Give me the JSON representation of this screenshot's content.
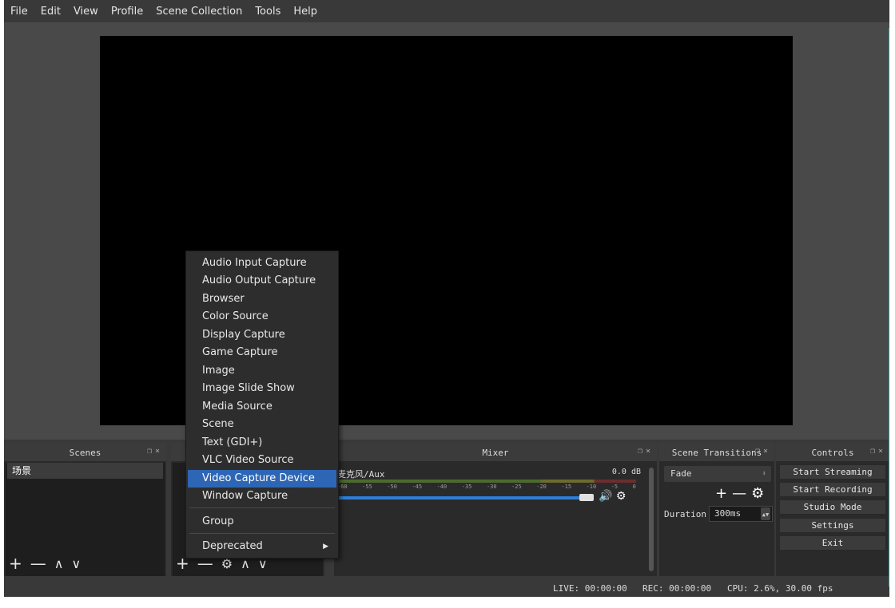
{
  "menubar": [
    "File",
    "Edit",
    "View",
    "Profile",
    "Scene Collection",
    "Tools",
    "Help"
  ],
  "docks": {
    "scenes": {
      "title": "Scenes",
      "items": [
        "场景"
      ]
    },
    "mixer": {
      "title": "Mixer",
      "track_name": "麦克风/Aux",
      "db": "0.0 dB",
      "ticks": [
        "-60",
        "-55",
        "-50",
        "-45",
        "-40",
        "-35",
        "-30",
        "-25",
        "-20",
        "-15",
        "-10",
        "-5",
        "0"
      ],
      "volume_level": 0.82
    },
    "transitions": {
      "title": "Scene Transitions",
      "selected": "Fade",
      "duration_label": "Duration",
      "duration_value": "300ms"
    },
    "controls": {
      "title": "Controls",
      "buttons": [
        "Start Streaming",
        "Start Recording",
        "Studio Mode",
        "Settings",
        "Exit"
      ]
    }
  },
  "context_menu": {
    "items": [
      "Audio Input Capture",
      "Audio Output Capture",
      "Browser",
      "Color Source",
      "Display Capture",
      "Game Capture",
      "Image",
      "Image Slide Show",
      "Media Source",
      "Scene",
      "Text (GDI+)",
      "VLC Video Source",
      "Video Capture Device",
      "Window Capture"
    ],
    "selected": "Video Capture Device",
    "group": "Group",
    "deprecated": "Deprecated"
  },
  "status": {
    "live": "LIVE: 00:00:00",
    "rec": "REC: 00:00:00",
    "cpu": "CPU: 2.6%, 30.00 fps"
  },
  "colors": {
    "accent": "#2d66b5",
    "volume": "#2f7fd8",
    "background": "#3a393a"
  }
}
